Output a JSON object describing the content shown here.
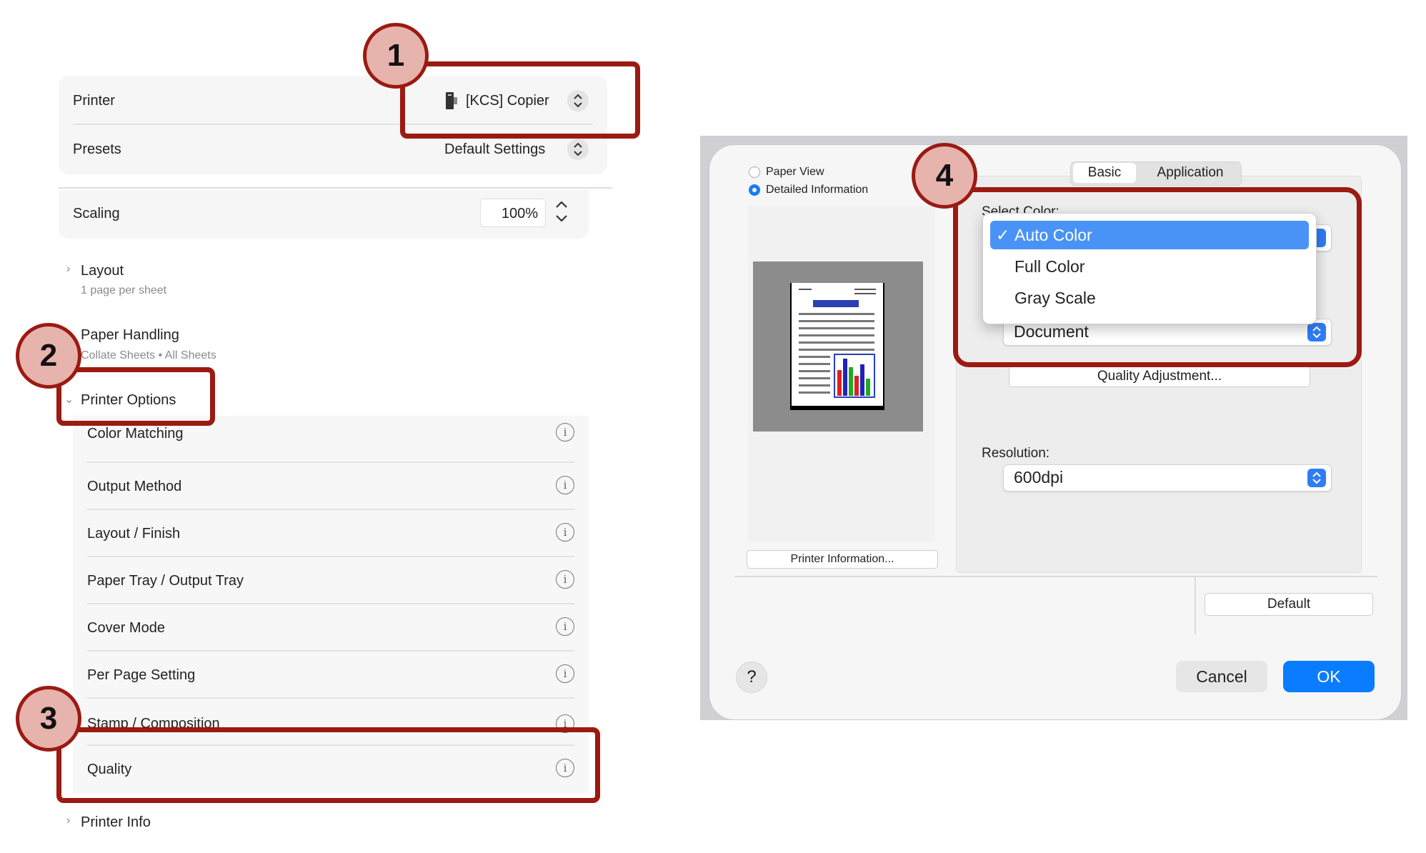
{
  "left_panel": {
    "printer": {
      "label": "Printer",
      "value": "[KCS] Copier"
    },
    "presets": {
      "label": "Presets",
      "value": "Default Settings"
    },
    "scaling": {
      "label": "Scaling",
      "value": "100%"
    },
    "layout": {
      "title": "Layout",
      "subtitle": "1 page per sheet"
    },
    "paper_handling": {
      "title": "Paper Handling",
      "subtitle": "Collate Sheets • All Sheets"
    },
    "printer_options": {
      "title": "Printer Options",
      "items": [
        {
          "label": "Color Matching"
        },
        {
          "label": "Output Method"
        },
        {
          "label": "Layout / Finish"
        },
        {
          "label": "Paper Tray / Output Tray"
        },
        {
          "label": "Cover Mode"
        },
        {
          "label": "Per Page Setting"
        },
        {
          "label": "Stamp / Composition"
        },
        {
          "label": "Quality"
        }
      ]
    },
    "printer_info": {
      "title": "Printer Info"
    }
  },
  "annotations": {
    "b1": "1",
    "b2": "2",
    "b3": "3",
    "b4": "4"
  },
  "dialog": {
    "view_options": {
      "paper_view": "Paper View",
      "detailed_info": "Detailed Information",
      "selected": "Detailed Information"
    },
    "printer_information_button": "Printer Information...",
    "tabs": {
      "basic": "Basic",
      "application": "Application",
      "active": "Basic"
    },
    "select_color_label": "Select Color:",
    "color_menu": {
      "items": [
        "Auto Color",
        "Full Color",
        "Gray Scale"
      ],
      "selected": "Auto Color",
      "check": "✓"
    },
    "document_select": "Document",
    "quality_adjustment_button": "Quality Adjustment...",
    "resolution": {
      "label": "Resolution:",
      "value": "600dpi"
    },
    "default_button": "Default",
    "help_button": "?",
    "cancel_button": "Cancel",
    "ok_button": "OK",
    "colors": {
      "accent": "#0a7cff",
      "annotation": "#9b1a12",
      "badge_fill": "#e6b3ad"
    }
  }
}
